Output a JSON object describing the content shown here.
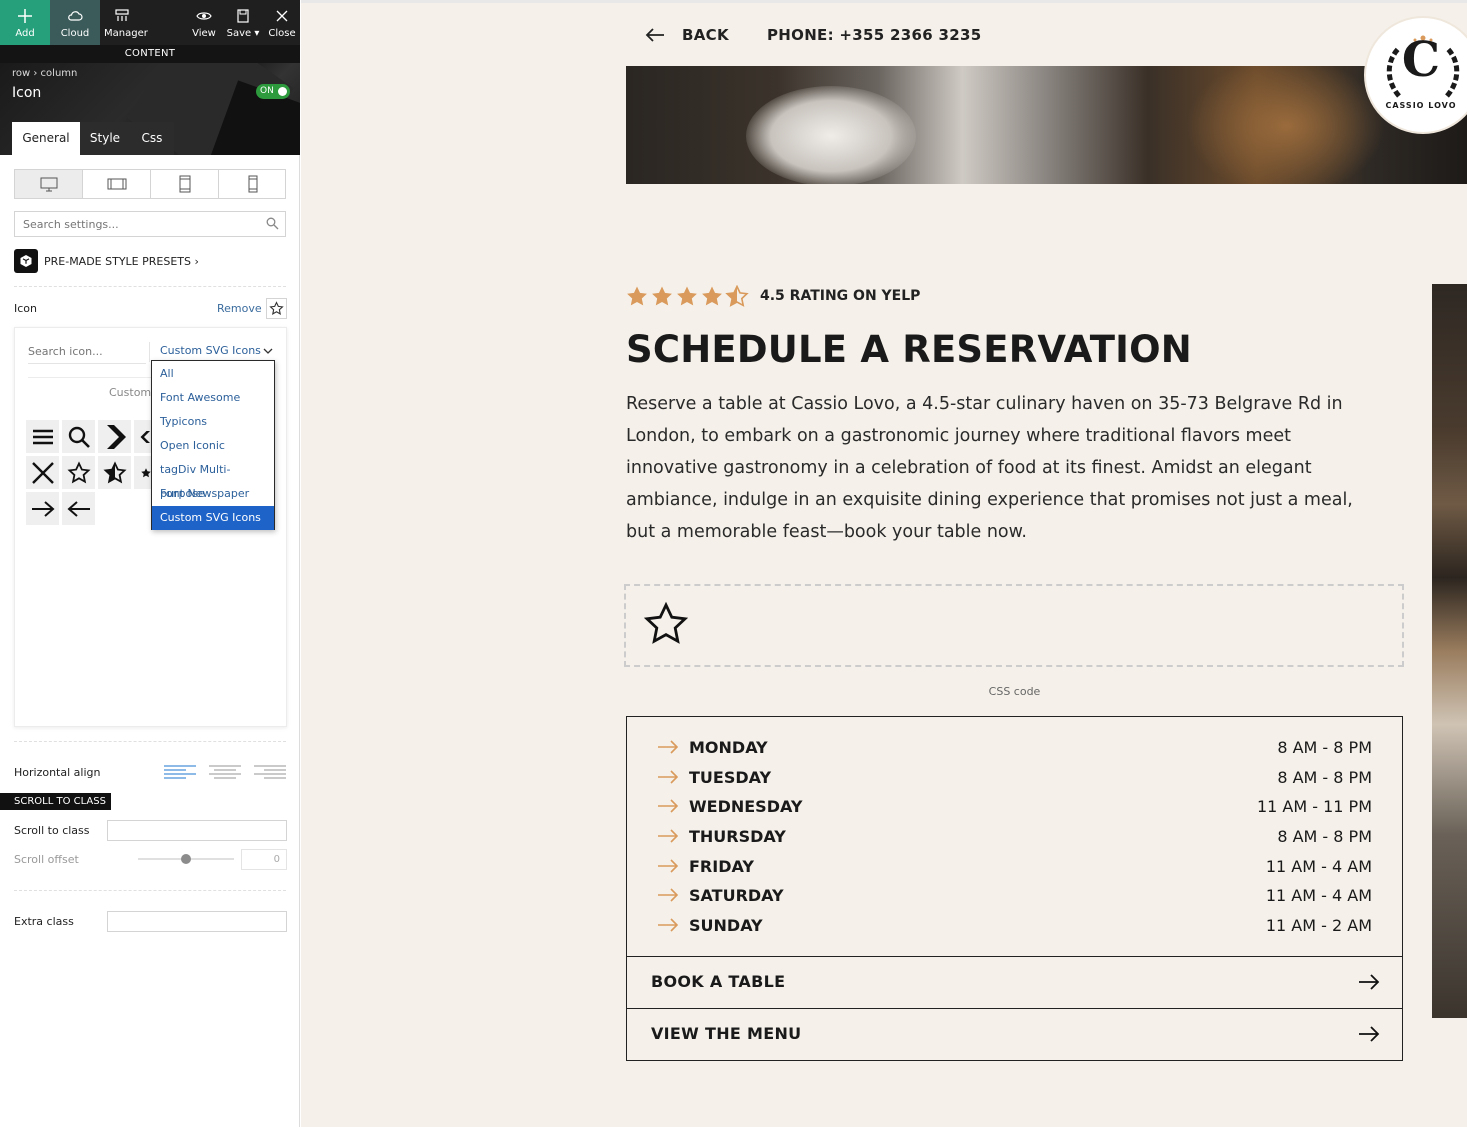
{
  "toolbar": {
    "add": "Add",
    "cloud": "Cloud",
    "manager": "Manager",
    "view": "View",
    "save": "Save",
    "close": "Close"
  },
  "panel": {
    "section_label": "CONTENT",
    "breadcrumb": "row › column",
    "element_title": "Icon",
    "toggle": "ON",
    "tabs": [
      "General",
      "Style",
      "Css"
    ],
    "search_placeholder": "Search settings...",
    "presets_label": "PRE-MADE STYLE PRESETS ›",
    "icon_label": "Icon",
    "remove_label": "Remove",
    "icon_picker": {
      "search_placeholder": "Search icon...",
      "selected_library": "Custom SVG Icons",
      "category_label": "Custom",
      "library_options": [
        "All",
        "Font Awesome",
        "Typicons",
        "Open Iconic",
        "tagDiv Multi-purpose",
        "Font Newspaper",
        "Custom SVG Icons"
      ],
      "icons": [
        "menu-icon",
        "search-icon",
        "chevron-right-icon",
        "chevron-left-icon",
        "close-icon",
        "star-outline-icon",
        "star-half-icon",
        "star-filled-icon",
        "arrow-right-icon",
        "arrow-left-icon"
      ]
    },
    "horizontal_align_label": "Horizontal align",
    "scroll_section": "SCROLL TO CLASS",
    "scroll_to_class_label": "Scroll to class",
    "scroll_offset_label": "Scroll offset",
    "scroll_offset_value": "0",
    "extra_class_label": "Extra class"
  },
  "preview": {
    "back": "BACK",
    "phone": "PHONE: +355 2366 3235",
    "logo_letter": "C",
    "logo_text": "CASSIO LOVO",
    "rating": 4.5,
    "rating_text": "4.5 RATING ON YELP",
    "heading": "SCHEDULE A RESERVATION",
    "description": "Reserve a table at Cassio Lovo, a 4.5-star culinary haven on 35-73 Belgrave Rd in London, to embark on a gastronomic journey where traditional flavors meet innovative gastronomy in a celebration of food at its finest. Amidst an elegant ambiance, indulge in an exquisite dining experience that promises not just a meal, but a memorable feast—book your table now.",
    "css_code_label": "CSS code",
    "hours": [
      {
        "day": "MONDAY",
        "time": "8 AM - 8 PM"
      },
      {
        "day": "TUESDAY",
        "time": "8 AM - 8 PM"
      },
      {
        "day": "WEDNESDAY",
        "time": "11 AM - 11 PM"
      },
      {
        "day": "THURSDAY",
        "time": "8 AM - 8 PM"
      },
      {
        "day": "FRIDAY",
        "time": "11 AM - 4 AM"
      },
      {
        "day": "SATURDAY",
        "time": "11 AM - 4 AM"
      },
      {
        "day": "SUNDAY",
        "time": "11 AM - 2 AM"
      }
    ],
    "book_table": "BOOK A TABLE",
    "view_menu": "VIEW THE MENU"
  },
  "colors": {
    "accent_green": "#25a07a",
    "link_blue": "#2b5f9a",
    "select_blue": "#1e63c8",
    "star_orange": "#d99a5b",
    "preview_bg": "#f5f1ea"
  }
}
